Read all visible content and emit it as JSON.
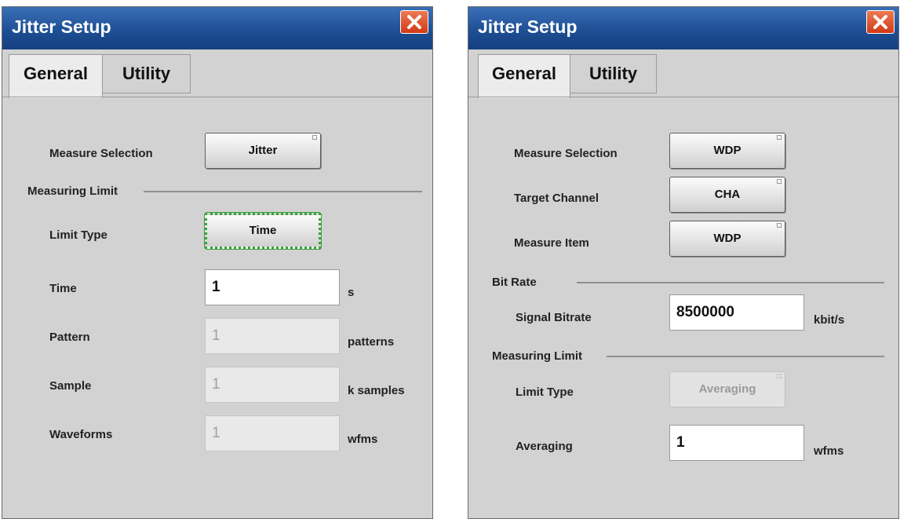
{
  "left": {
    "title": "Jitter Setup",
    "tabs": {
      "general": "General",
      "utility": "Utility"
    },
    "measure_selection": {
      "label": "Measure Selection",
      "value": "Jitter"
    },
    "section_measuring_limit": "Measuring Limit",
    "limit_type": {
      "label": "Limit Type",
      "value": "Time"
    },
    "time": {
      "label": "Time",
      "value": "1",
      "unit": "s"
    },
    "pattern": {
      "label": "Pattern",
      "value": "1",
      "unit": "patterns"
    },
    "sample": {
      "label": "Sample",
      "value": "1",
      "unit": "k samples"
    },
    "waveforms": {
      "label": "Waveforms",
      "value": "1",
      "unit": "wfms"
    }
  },
  "right": {
    "title": "Jitter Setup",
    "tabs": {
      "general": "General",
      "utility": "Utility"
    },
    "measure_selection": {
      "label": "Measure Selection",
      "value": "WDP"
    },
    "target_channel": {
      "label": "Target Channel",
      "value": "CHA"
    },
    "measure_item": {
      "label": "Measure Item",
      "value": "WDP"
    },
    "section_bit_rate": "Bit Rate",
    "signal_bitrate": {
      "label": "Signal Bitrate",
      "value": "8500000",
      "unit": "kbit/s"
    },
    "section_measuring_limit": "Measuring Limit",
    "limit_type": {
      "label": "Limit Type",
      "value": "Averaging"
    },
    "averaging": {
      "label": "Averaging",
      "value": "1",
      "unit": "wfms"
    }
  },
  "colors": {
    "titlebar": "#1d4d93",
    "close": "#d23a16",
    "focus": "#3aa13a",
    "panel": "#d2d2d2"
  },
  "icons": {
    "close": "close-icon"
  }
}
